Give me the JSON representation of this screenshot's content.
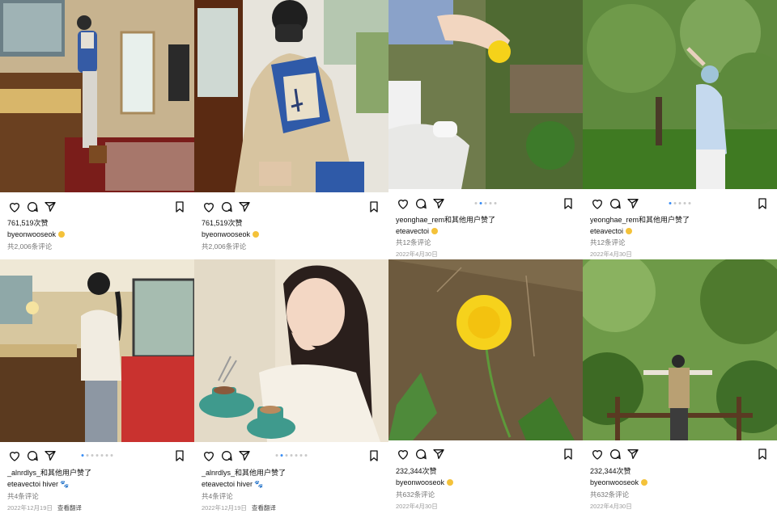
{
  "posts": [
    {
      "likes": "761,519次赞",
      "owner": "byeonwooseok",
      "owner_emoji": "smile-emoji",
      "comments": "共2,006条评论",
      "date": "",
      "translate": ""
    },
    {
      "likes": "761,519次赞",
      "owner": "byeonwooseok",
      "owner_emoji": "smile-emoji",
      "comments": "共2,006条评论",
      "date": "",
      "translate": ""
    },
    {
      "likes": "yeonghae_rem和其他用户赞了",
      "owner": "eteavectoi",
      "owner_emoji": "hand-emoji",
      "comments": "共12条评论",
      "date": "2022年4月30日",
      "translate": ""
    },
    {
      "likes": "yeonghae_rem和其他用户赞了",
      "owner": "eteavectoi",
      "owner_emoji": "hand-emoji",
      "comments": "共12条评论",
      "date": "2022年4月30日",
      "translate": ""
    },
    {
      "likes": "_alnrdlys_和其他用户赞了",
      "owner": "eteavectoi",
      "owner_suffix": "hiver",
      "owner_emoji": "paw-emoji",
      "comments": "共4条评论",
      "date": "2022年12月19日",
      "translate": "查看翻译"
    },
    {
      "likes": "_alnrdlys_和其他用户赞了",
      "owner": "eteavectoi",
      "owner_suffix": "hiver",
      "owner_emoji": "paw-emoji",
      "comments": "共4条评论",
      "date": "2022年12月19日",
      "translate": "查看翻译"
    },
    {
      "likes": "232,344次赞",
      "owner": "byeonwooseok",
      "owner_emoji": "smile-emoji",
      "comments": "共632条评论",
      "date": "2022年4月30日",
      "translate": ""
    },
    {
      "likes": "232,344次赞",
      "owner": "byeonwooseok",
      "owner_emoji": "smile-emoji",
      "comments": "共632条评论",
      "date": "2022年4月30日",
      "translate": ""
    }
  ],
  "paw_glyph": "🐾",
  "colors": {
    "accent_dot": "#3a8df5",
    "text": "#111111",
    "muted": "#777777"
  }
}
